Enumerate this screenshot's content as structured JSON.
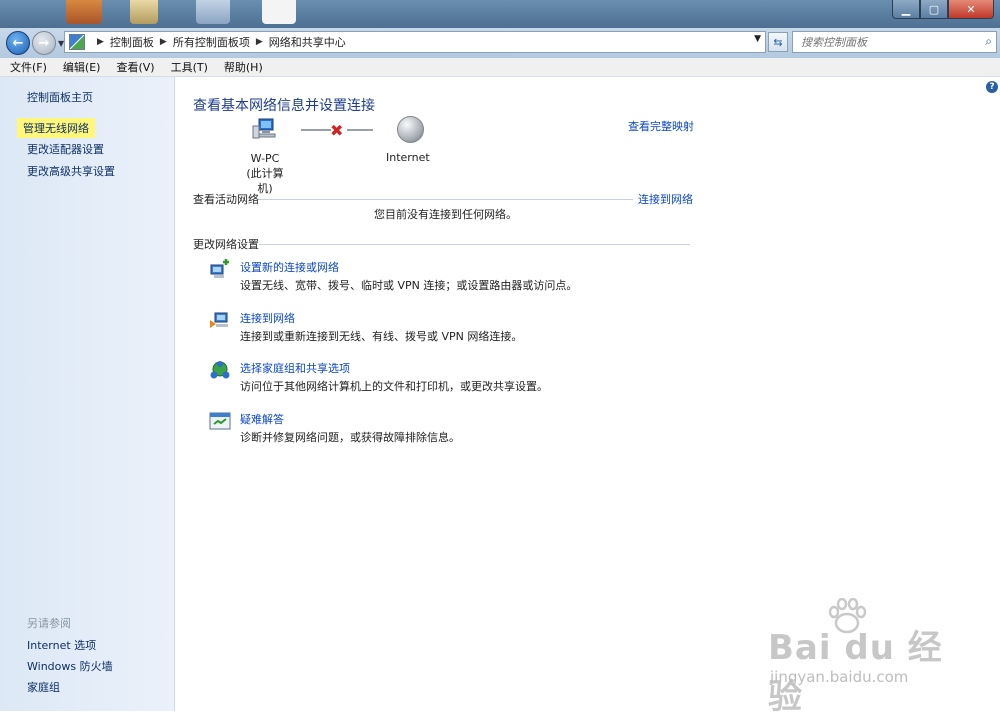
{
  "window": {
    "minimize": "▁",
    "maximize": "▢",
    "close": "✕"
  },
  "address_bar": {
    "crumbs": [
      "控制面板",
      "所有控制面板项",
      "网络和共享中心"
    ],
    "search_placeholder": "搜索控制面板"
  },
  "menu": [
    "文件(F)",
    "编辑(E)",
    "查看(V)",
    "工具(T)",
    "帮助(H)"
  ],
  "sidebar": {
    "home": "控制面板主页",
    "items": [
      "管理无线网络",
      "更改适配器设置",
      "更改高级共享设置"
    ],
    "see_also_title": "另请参阅",
    "see_also": [
      "Internet 选项",
      "Windows 防火墙",
      "家庭组"
    ]
  },
  "main": {
    "title": "查看基本网络信息并设置连接",
    "view_full_map": "查看完整映射",
    "computer_name": "W-PC",
    "computer_sub": "(此计算机)",
    "internet_label": "Internet",
    "active_networks_head": "查看活动网络",
    "connect_to_network": "连接到网络",
    "no_connection_msg": "您目前没有连接到任何网络。",
    "change_settings_head": "更改网络设置",
    "tasks": [
      {
        "title": "设置新的连接或网络",
        "desc": "设置无线、宽带、拨号、临时或 VPN 连接；或设置路由器或访问点。",
        "icon": "new-connection-icon"
      },
      {
        "title": "连接到网络",
        "desc": "连接到或重新连接到无线、有线、拨号或 VPN 网络连接。",
        "icon": "connect-network-icon"
      },
      {
        "title": "选择家庭组和共享选项",
        "desc": "访问位于其他网络计算机上的文件和打印机，或更改共享设置。",
        "icon": "homegroup-icon"
      },
      {
        "title": "疑难解答",
        "desc": "诊断并修复网络问题，或获得故障排除信息。",
        "icon": "troubleshoot-icon"
      }
    ]
  },
  "watermark": {
    "brand": "Bai du 经验",
    "url": "jingyan.baidu.com"
  },
  "colors": {
    "link": "#0d47c5",
    "title": "#1e3d8f",
    "highlight": "#fff77a",
    "sidebar_bg": "#dde8f6"
  }
}
